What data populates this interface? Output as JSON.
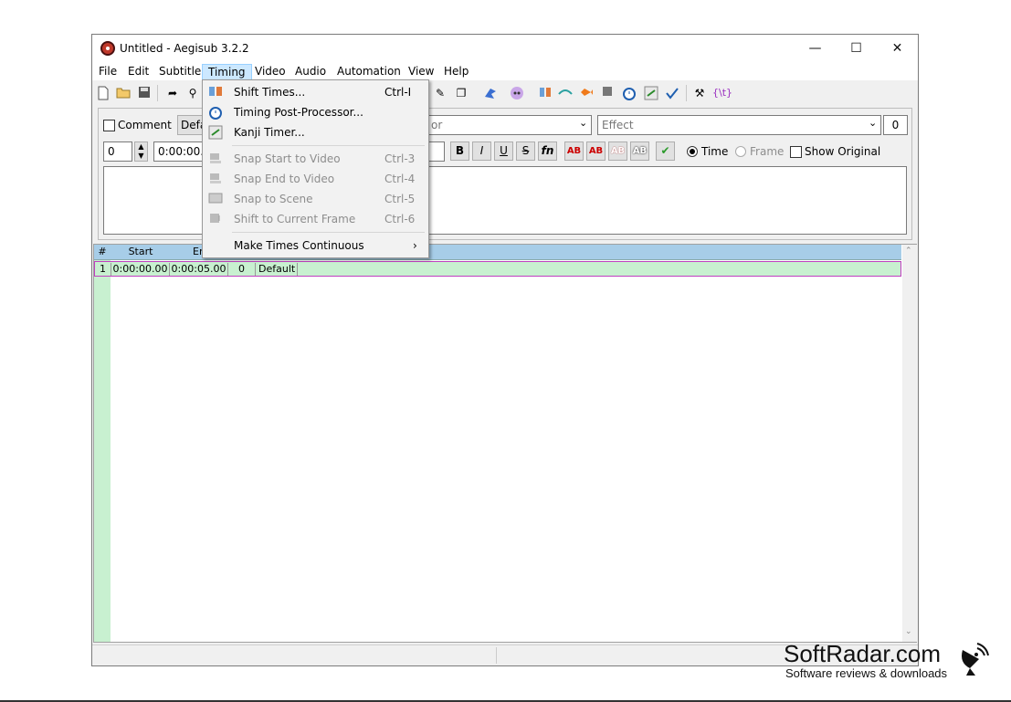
{
  "window": {
    "title": "Untitled - Aegisub 3.2.2",
    "controls": {
      "minimize": "—",
      "maximize": "☐",
      "close": "✕"
    }
  },
  "menubar": {
    "items": [
      "File",
      "Edit",
      "Subtitle",
      "Timing",
      "Video",
      "Audio",
      "Automation",
      "View",
      "Help"
    ],
    "active": "Timing"
  },
  "toolbar": {
    "icons": [
      "new-file-icon",
      "open-folder-icon",
      "save-icon",
      "jump-icon",
      "zoom-icon",
      "pencil-icon",
      "copy-style-icon",
      "bird-icon",
      "anime-face-icon",
      "split-icon",
      "shift-icon",
      "fish-icon",
      "stop-icon",
      "timer-icon",
      "kanji-icon",
      "spellcheck-icon",
      "tools-icon",
      "tag-icon"
    ],
    "tag_label": "{\\t}"
  },
  "edit_panel": {
    "comment_label": "Comment",
    "style_value": "Defa",
    "actor_placeholder": "or",
    "effect_placeholder": "Effect",
    "margin_value": "0",
    "layer_value": "0",
    "start_time": "0:00:00.00",
    "bold": "B",
    "italic": "I",
    "underline": "U",
    "strike": "S",
    "font": "fn",
    "ab": "AB",
    "time_label": "Time",
    "frame_label": "Frame",
    "show_original_label": "Show Original"
  },
  "grid": {
    "headers": [
      "#",
      "Start",
      "En"
    ],
    "rows": [
      {
        "num": "1",
        "start": "0:00:00.00",
        "end": "0:00:05.00",
        "layer": "0",
        "style": "Default"
      }
    ]
  },
  "timing_menu": {
    "items": [
      {
        "label": "Shift Times...",
        "shortcut": "Ctrl-I",
        "icon": "shift-times-icon",
        "enabled": true
      },
      {
        "label": "Timing Post-Processor...",
        "shortcut": "",
        "icon": "post-processor-icon",
        "enabled": true
      },
      {
        "label": "Kanji Timer...",
        "shortcut": "",
        "icon": "kanji-timer-icon",
        "enabled": true
      },
      {
        "label": "Snap Start to Video",
        "shortcut": "Ctrl-3",
        "icon": "snap-start-icon",
        "enabled": false
      },
      {
        "label": "Snap End to Video",
        "shortcut": "Ctrl-4",
        "icon": "snap-end-icon",
        "enabled": false
      },
      {
        "label": "Snap to Scene",
        "shortcut": "Ctrl-5",
        "icon": "snap-scene-icon",
        "enabled": false
      },
      {
        "label": "Shift to Current Frame",
        "shortcut": "Ctrl-6",
        "icon": "shift-frame-icon",
        "enabled": false
      },
      {
        "label": "Make Times Continuous",
        "shortcut": "",
        "icon": "",
        "enabled": true,
        "submenu": "›"
      }
    ]
  },
  "watermark": {
    "title": "SoftRadar.com",
    "subtitle": "Software reviews & downloads"
  },
  "colors": {
    "grid_header": "#a7cde8",
    "grid_row": "#c8f0d0",
    "menu_active": "#cce8ff"
  }
}
